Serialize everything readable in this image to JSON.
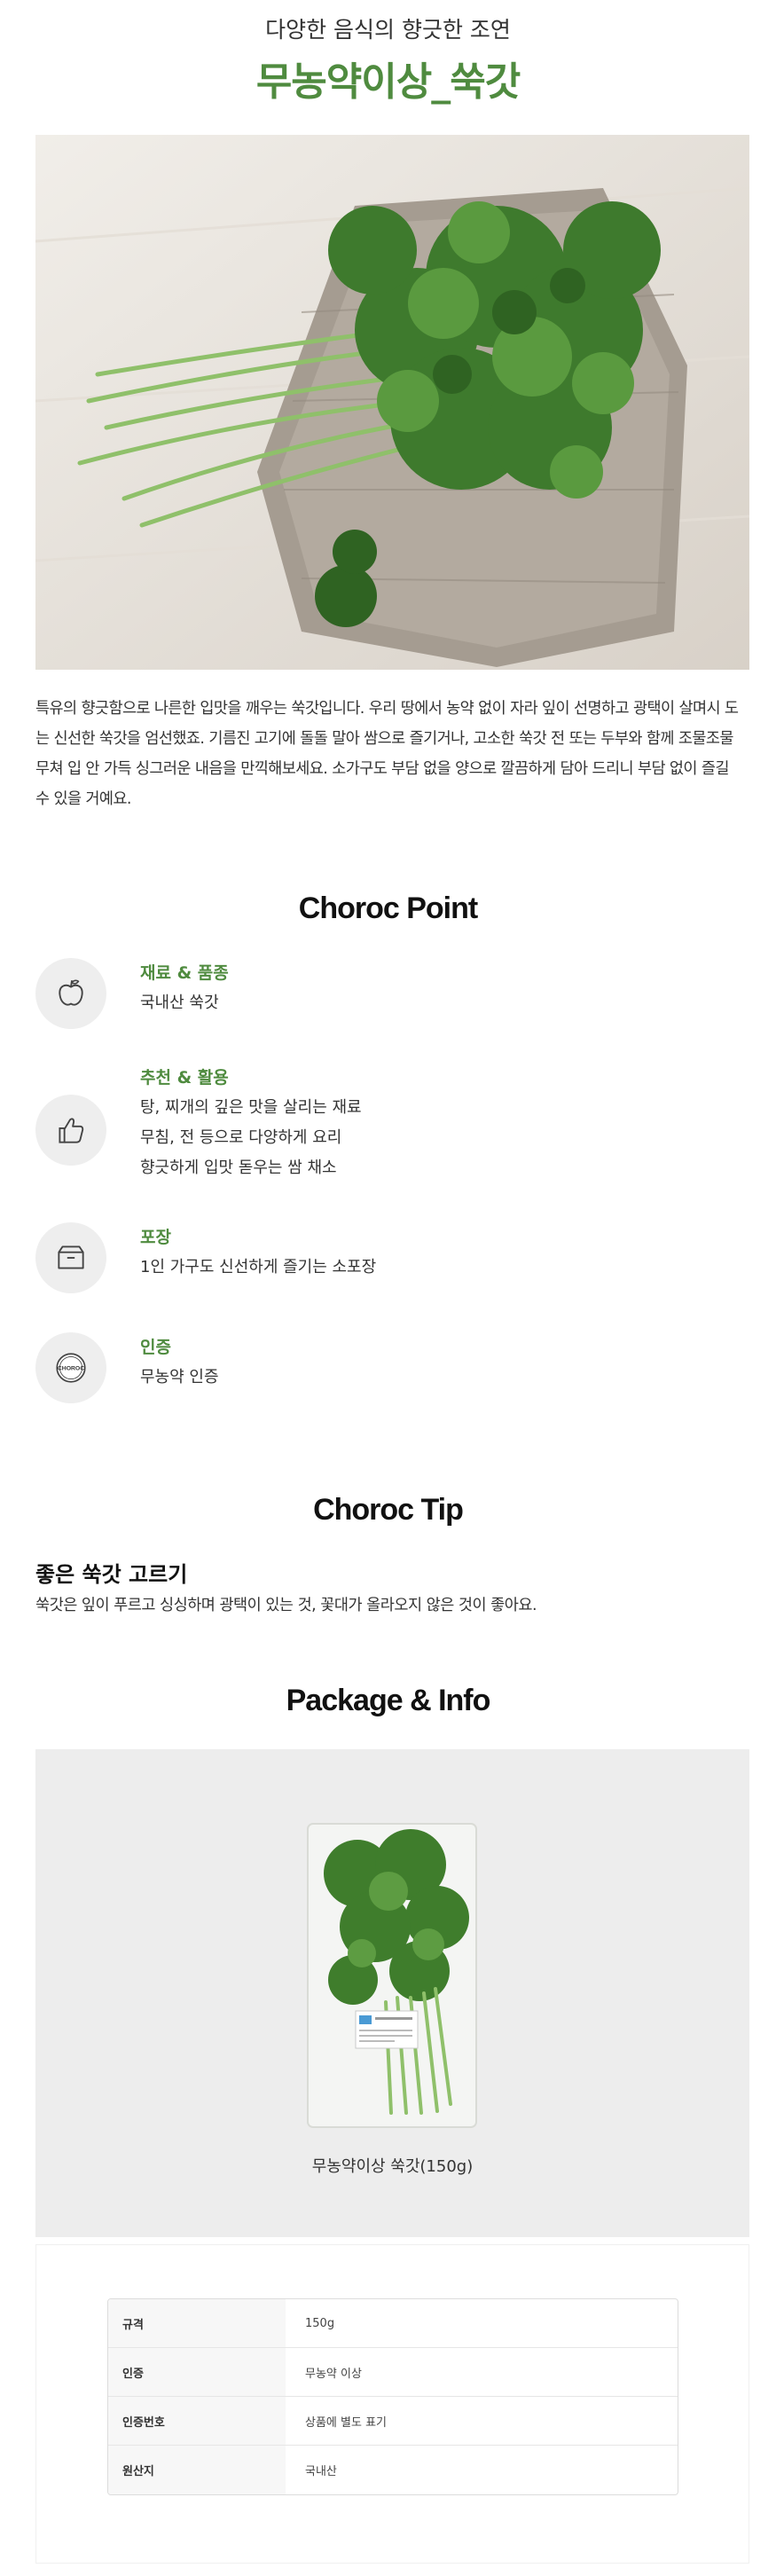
{
  "header": {
    "subtitle": "다양한 음식의 향긋한 조연",
    "title": "무농약이상_쑥갓"
  },
  "description": "특유의 향긋함으로 나른한 입맛을 깨우는 쑥갓입니다. 우리 땅에서 농약 없이 자라 잎이 선명하고 광택이 살며시 도는 신선한 쑥갓을 엄선했죠. 기름진 고기에 돌돌 말아 쌈으로 즐기거나, 고소한 쑥갓 전 또는 두부와 함께 조물조물 무쳐 입 안 가득 싱그러운 내음을 만끽해보세요. 소가구도 부담 없을 양으로 깔끔하게 담아 드리니 부담 없이 즐길 수 있을 거예요.",
  "point": {
    "title": "Choroc Point",
    "items": [
      {
        "icon": "apple-icon",
        "label": "재료 & 품종",
        "lines": [
          "국내산 쑥갓"
        ]
      },
      {
        "icon": "thumbs-up-icon",
        "label": "추천 & 활용",
        "lines": [
          "탕, 찌개의 깊은 맛을 살리는 재료",
          "무침, 전 등으로 다양하게 요리",
          "향긋하게 입맛 돋우는 쌈 채소"
        ]
      },
      {
        "icon": "box-icon",
        "label": "포장",
        "lines": [
          "1인 가구도 신선하게 즐기는 소포장"
        ]
      },
      {
        "icon": "choroc-seal-icon",
        "label": "인증",
        "lines": [
          "무농약 인증"
        ]
      }
    ]
  },
  "tip": {
    "title": "Choroc Tip",
    "heading": "좋은 쑥갓 고르기",
    "body": "쑥갓은 잎이 푸르고 싱싱하며 광택이 있는 것, 꽃대가 올라오지 않은 것이 좋아요."
  },
  "package": {
    "title": "Package & Info",
    "caption": "무농약이상 쑥갓(150g)",
    "seal_text": "CHOROC"
  },
  "info": {
    "rows": [
      {
        "key": "규격",
        "value": "150g"
      },
      {
        "key": "인증",
        "value": "무농약 이상"
      },
      {
        "key": "인증번호",
        "value": "상품에 별도 표기"
      },
      {
        "key": "원산지",
        "value": "국내산"
      }
    ]
  },
  "colors": {
    "accent_green": "#4f8b3f",
    "icon_bg": "#eeeeee",
    "package_bg": "#ededed"
  }
}
